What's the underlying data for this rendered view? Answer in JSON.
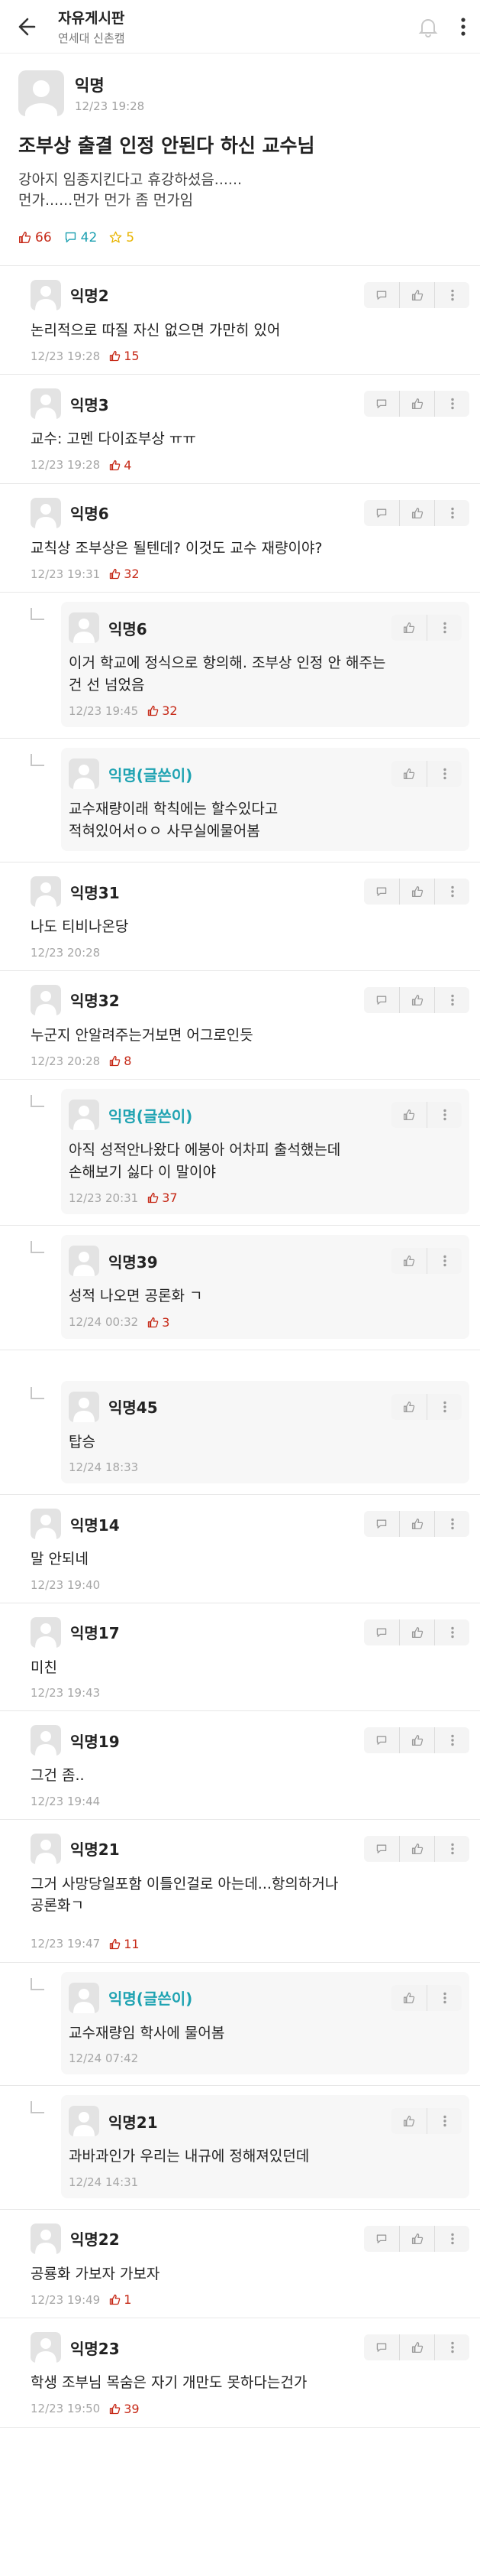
{
  "header": {
    "board_title": "자유게시판",
    "board_subtitle": "연세대 신촌캠"
  },
  "post": {
    "author": "익명",
    "time": "12/23 19:28",
    "title": "조부상 출결 인정 안된다 하신 교수님",
    "body_lines": [
      "강아지 임종지킨다고 휴강하셨음......",
      "먼가......먼가 먼가 좀 먼가임"
    ],
    "likes": "66",
    "comments": "42",
    "scraps": "5"
  },
  "comments": [
    {
      "name": "익명2",
      "lines": [
        "논리적으로 따질 자신 없으면 가만히 있어"
      ],
      "time": "12/23 19:28",
      "likes": "15"
    },
    {
      "name": "익명3",
      "lines": [
        "교수: 고멘 다이죠부상 ㅠㅠ"
      ],
      "time": "12/23 19:28",
      "likes": "4"
    },
    {
      "name": "익명6",
      "lines": [
        "교칙상 조부상은 될텐데? 이것도 교수 재량이야?"
      ],
      "time": "12/23 19:31",
      "likes": "32"
    },
    {
      "name": "익명6",
      "lines": [
        "이거 학교에 정식으로 항의해. 조부상 인정 안 해주는",
        "건 선 넘었음"
      ],
      "time": "12/23 19:45",
      "likes": "32"
    },
    {
      "name": "익명(글쓴이)",
      "lines": [
        "교수재량이래 학칙에는 할수있다고",
        "적혀있어서ㅇㅇ 사무실에물어봄"
      ],
      "time": "",
      "likes": ""
    },
    {
      "name": "익명31",
      "lines": [
        "나도 티비나온당"
      ],
      "time": "12/23 20:28",
      "likes": ""
    },
    {
      "name": "익명32",
      "lines": [
        "누군지 안알려주는거보면 어그로인듯"
      ],
      "time": "12/23 20:28",
      "likes": "8"
    },
    {
      "name": "익명(글쓴이)",
      "lines": [
        "아직 성적안나왔다 에붕아 어차피 출석했는데",
        "손해보기 싫다 이 말이야"
      ],
      "time": "12/23 20:31",
      "likes": "37"
    },
    {
      "name": "익명39",
      "lines": [
        "성적 나오면 공론화 ㄱ"
      ],
      "time": "12/24 00:32",
      "likes": "3"
    },
    {
      "name": "익명45",
      "lines": [
        "탑승"
      ],
      "time": "12/24 18:33",
      "likes": ""
    },
    {
      "name": "익명14",
      "lines": [
        "말 안되네"
      ],
      "time": "12/23 19:40",
      "likes": ""
    },
    {
      "name": "익명17",
      "lines": [
        "미친"
      ],
      "time": "12/23 19:43",
      "likes": ""
    },
    {
      "name": "익명19",
      "lines": [
        "그건 좀.."
      ],
      "time": "12/23 19:44",
      "likes": ""
    },
    {
      "name": "익명21",
      "lines": [
        "그거 사망당일포함 이틀인걸로 아는데...항의하거나",
        "공론화ㄱ"
      ],
      "time": "12/23 19:47",
      "likes": "11"
    },
    {
      "name": "익명(글쓴이)",
      "lines": [
        "교수재량임 학사에 물어봄"
      ],
      "time": "12/24 07:42",
      "likes": ""
    },
    {
      "name": "익명21",
      "lines": [
        "과바과인가 우리는 내규에 정해져있던데"
      ],
      "time": "12/24 14:31",
      "likes": ""
    },
    {
      "name": "익명22",
      "lines": [
        "공룡화 가보자 가보자"
      ],
      "time": "12/23 19:49",
      "likes": "1"
    },
    {
      "name": "익명23",
      "lines": [
        "학생 조부님 목숨은 자기 개만도 못하다는건가"
      ],
      "time": "12/23 19:50",
      "likes": "39"
    }
  ],
  "colors": {
    "like": "#c62917",
    "op": "#1fa3b2",
    "scrap": "#e8b400"
  },
  "icons": {
    "back": "back-arrow-icon",
    "bell": "bell-icon",
    "more": "more-vertical-icon",
    "comment": "comment-icon",
    "like": "thumbs-up-icon"
  }
}
